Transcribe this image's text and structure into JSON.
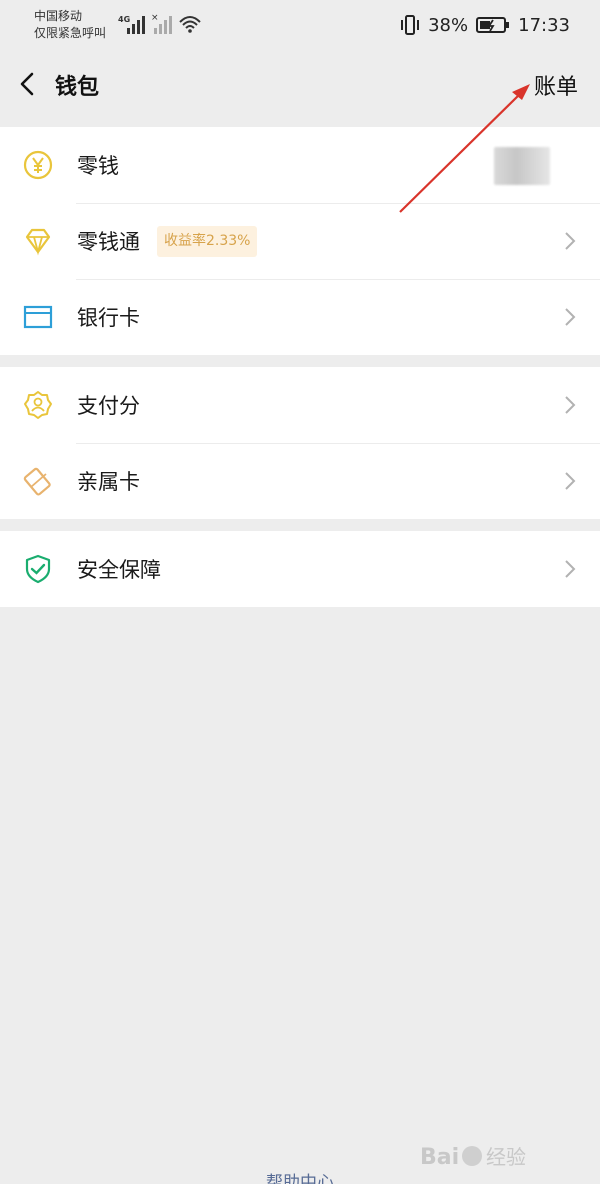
{
  "status_bar": {
    "carrier": "中国移动",
    "carrier_note": "仅限紧急呼叫",
    "network": "4G",
    "battery": "38%",
    "time": "17:33"
  },
  "nav": {
    "title": "钱包",
    "bill_label": "账单"
  },
  "wallet_group": [
    {
      "label": "零钱",
      "icon": "yuan-coin-icon"
    },
    {
      "label": "零钱通",
      "icon": "diamond-icon",
      "badge": "收益率2.33%"
    },
    {
      "label": "银行卡",
      "icon": "bank-card-icon"
    }
  ],
  "service_group": [
    {
      "label": "支付分",
      "icon": "badge-person-icon"
    },
    {
      "label": "亲属卡",
      "icon": "family-card-icon"
    }
  ],
  "security_group": [
    {
      "label": "安全保障",
      "icon": "shield-check-icon"
    }
  ],
  "footer": {
    "help_center": "帮助中心"
  },
  "watermark": {
    "text": "经验"
  },
  "colors": {
    "background": "#ededed",
    "accent_yellow": "#e9c53b",
    "bank_blue": "#2d9fd8",
    "shield_green": "#1aad6f",
    "badge_text": "#d7a34b",
    "annotation_red": "#d9342b"
  }
}
